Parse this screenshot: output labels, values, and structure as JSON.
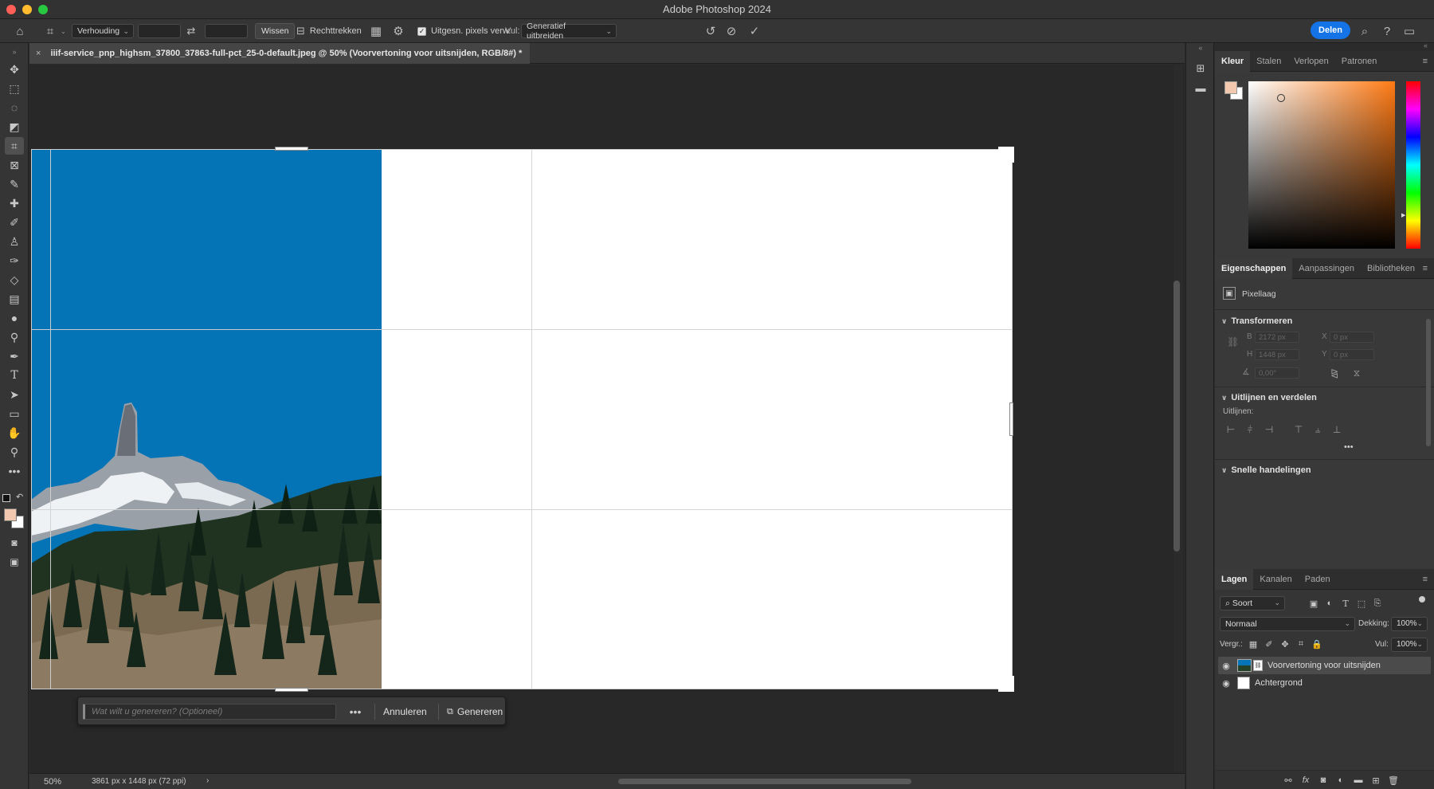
{
  "window": {
    "title": "Adobe Photoshop 2024"
  },
  "options_bar": {
    "ratio_select": "Verhouding",
    "clear_label": "Wissen",
    "straighten_label": "Rechttrekken",
    "delete_pixels_label": "Uitgesn. pixels verw.",
    "fill_label": "Vul:",
    "fill_select": "Generatief uitbreiden",
    "share_label": "Delen"
  },
  "document": {
    "tab_title": "iiif-service_pnp_highsm_37800_37863-full-pct_25-0-default.jpeg @ 50% (Voorvertoning voor uitsnijden, RGB/8#) *",
    "close_symbol": "×"
  },
  "gen_bar": {
    "prompt_placeholder": "Wat wilt u genereren?  (Optioneel)",
    "more_symbol": "•••",
    "cancel_label": "Annuleren",
    "generate_label": "Genereren"
  },
  "status": {
    "zoom": "50%",
    "dimensions": "3861 px x 1448 px (72 ppi)",
    "arrow": "›"
  },
  "color_panel": {
    "tabs": [
      "Kleur",
      "Stalen",
      "Verlopen",
      "Patronen"
    ],
    "foreground": "#f2c9ae",
    "background": "#ffffff"
  },
  "properties_panel": {
    "tabs": [
      "Eigenschappen",
      "Aanpassingen",
      "Bibliotheken"
    ],
    "layer_type": "Pixellaag",
    "transform_title": "Transformeren",
    "w_label": "B",
    "w_value": "2172 px",
    "h_label": "H",
    "h_value": "1448 px",
    "x_label": "X",
    "x_value": "0 px",
    "y_label": "Y",
    "y_value": "0 px",
    "angle_value": "0,00°",
    "align_title": "Uitlijnen en verdelen",
    "align_sub": "Uitlijnen:",
    "more_symbol": "•••",
    "quick_title": "Snelle handelingen"
  },
  "layers_panel": {
    "tabs": [
      "Lagen",
      "Kanalen",
      "Paden"
    ],
    "kind_select": "Soort",
    "blend_mode": "Normaal",
    "opacity_label": "Dekking:",
    "opacity_value": "100%",
    "lock_label": "Vergr.:",
    "fill_label": "Vul:",
    "fill_value": "100%",
    "layers": [
      {
        "name": "Voorvertoning voor uitsnijden"
      },
      {
        "name": "Achtergrond"
      }
    ]
  },
  "colors": {
    "accent": "#1473e6",
    "sky": "#0474b7"
  }
}
